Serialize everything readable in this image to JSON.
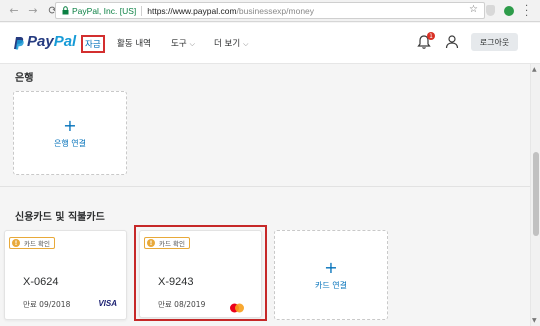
{
  "browser": {
    "site_identity": "PayPal, Inc. [US]",
    "url_main": "https://www.paypal.com",
    "url_path": "/businessexp/money"
  },
  "header": {
    "logo_pay": "Pay",
    "logo_pal": "Pal",
    "nav": {
      "money": "자금",
      "activity": "활동 내역",
      "tools": "도구",
      "more": "더 보기"
    },
    "notification_count": "1",
    "logout": "로그아웃"
  },
  "bank": {
    "title": "은행",
    "link_label": "은행 연결"
  },
  "cards": {
    "title": "신용카드 및 직불카드",
    "items": [
      {
        "badge": "카드 확인",
        "number": "X-0624",
        "expiry": "만료 09/2018",
        "brand": "VISA"
      },
      {
        "badge": "카드 확인",
        "number": "X-9243",
        "expiry": "만료 08/2019",
        "brand": "mastercard"
      }
    ],
    "link_label": "카드 연결"
  },
  "colors": {
    "accent": "#0070ba",
    "highlight": "#d32f2f",
    "warning": "#e8a93a"
  }
}
